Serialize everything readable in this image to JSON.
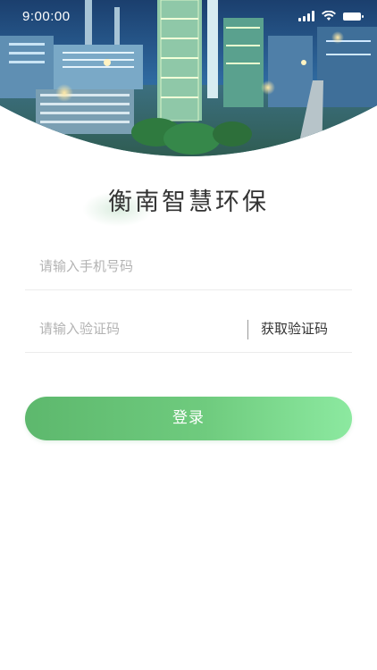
{
  "status_bar": {
    "time": "9:00:00"
  },
  "login": {
    "title": "衡南智慧环保",
    "phone_placeholder": "请输入手机号码",
    "code_placeholder": "请输入验证码",
    "get_code_label": "获取验证码",
    "submit_label": "登录"
  },
  "colors": {
    "accent_start": "#5db86d",
    "accent_end": "#8ce9a0",
    "title_text": "#333333",
    "placeholder_text": "#b3b3b3"
  },
  "icons": [
    "signal-icon",
    "wifi-icon",
    "battery-icon"
  ]
}
